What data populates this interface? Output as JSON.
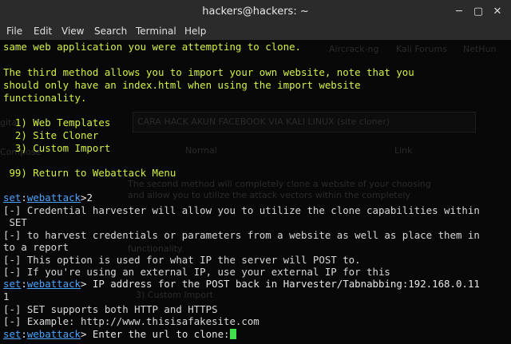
{
  "window": {
    "title": "hackers@hackers: ~",
    "minimize_glyph": "─",
    "maximize_glyph": "▢",
    "close_glyph": "✕"
  },
  "menu": [
    "File",
    "Edit",
    "View",
    "Search",
    "Terminal",
    "Help"
  ],
  "background_ghost": {
    "bookmarks": [
      "Aircrack-ng",
      "Kali Forums",
      "NetHun"
    ],
    "post_title": "CARA HACK AKUN FACEBOOK VIA KALI LINUX (site cloner)",
    "link_label": "Link",
    "left_fragment": "gita",
    "compose_label": "Compose",
    "editor_font": "Normal",
    "body_lines": [
      "The second method will completely clone a website of your choosing",
      "and allow you to utilize the attack vectors within the completely",
      "functionality.",
      "3) Custom Import"
    ]
  },
  "terminal": {
    "lines": [
      {
        "text": "same web application you were attempting to clone.",
        "style": "y"
      },
      {
        "text": "",
        "style": ""
      },
      {
        "text": "The third method allows you to import your own website, note that you",
        "style": "y"
      },
      {
        "text": "should only have an index.html when using the import website",
        "style": "y"
      },
      {
        "text": "functionality.",
        "style": "y"
      },
      {
        "text": "",
        "style": ""
      },
      {
        "text": "  1) Web Templates",
        "style": "y"
      },
      {
        "text": "  2) Site Cloner",
        "style": "y"
      },
      {
        "text": "  3) Custom Import",
        "style": "y"
      },
      {
        "text": "",
        "style": ""
      },
      {
        "text": " 99) Return to Webattack Menu",
        "style": "y"
      },
      {
        "text": "",
        "style": ""
      }
    ],
    "prompt_set": "set",
    "prompt_module": "webattack",
    "cmd1_tail": ">2",
    "log1": "[-] Credential harvester will allow you to utilize the clone capabilities within",
    "log1_cont": " SET",
    "log2": "[-] to harvest credentials or parameters from a website as well as place them in",
    "log2_cont": "to a report",
    "log3": "[-] This option is used for what IP the server will POST to.",
    "log4": "[-] If you're using an external IP, use your external IP for this",
    "cmd2_tail": "> IP address for the POST back in Harvester/Tabnabbing:192.168.0.11",
    "cmd2_cont": "1",
    "log5": "[-] SET supports both HTTP and HTTPS",
    "log6": "[-] Example: http://www.thisisafakesite.com",
    "cmd3_tail": "> Enter the url to clone:"
  },
  "colors": {
    "prompt_blue": "#4aa3ff",
    "yellow_text": "#d4f046",
    "cursor_green": "#3fe04a"
  }
}
